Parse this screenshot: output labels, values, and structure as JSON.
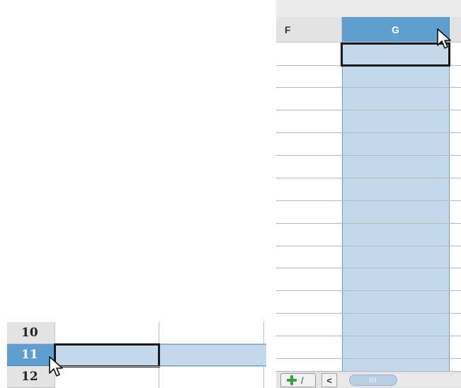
{
  "column_view": {
    "column_headers": [
      "F",
      "G"
    ],
    "selected_column": "G",
    "add_sheet_tab": {
      "icon": "plus-icon",
      "label": "/"
    },
    "scroll_left_label": "<",
    "scroll_thumb_grip": "III"
  },
  "row_view": {
    "row_headers": [
      "10",
      "11",
      "12"
    ],
    "selected_row": "11"
  },
  "colors": {
    "selection_header": "#5f9fd0",
    "selection_fill": "#c4d8eb",
    "header_bg": "#e3e3e3",
    "plus_green": "#2fa53a"
  }
}
